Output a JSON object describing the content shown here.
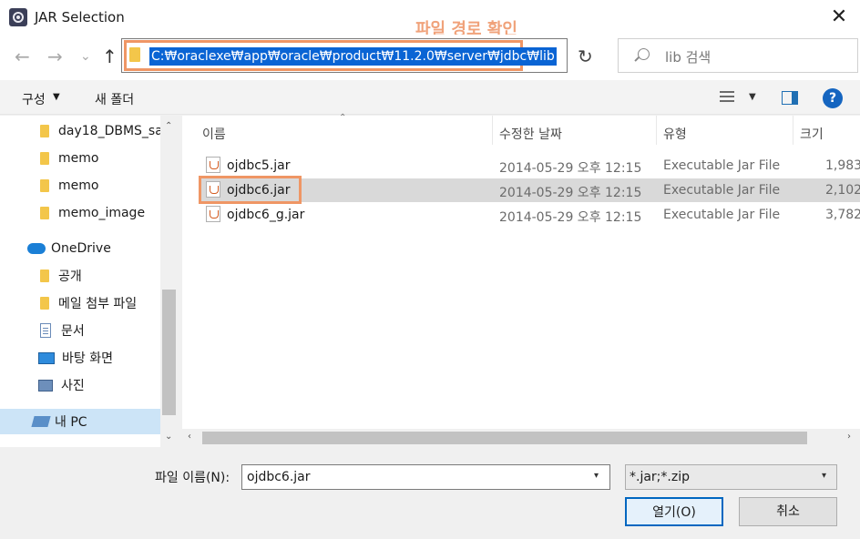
{
  "window": {
    "title": "JAR Selection",
    "close_glyph": "✕",
    "app_icon": "eclipse-icon"
  },
  "annotation": {
    "text": "파일 경로 확인",
    "color": "#ef9665"
  },
  "nav": {
    "back_glyph": "←",
    "forward_glyph": "→",
    "recent_glyph": "⌄",
    "up_glyph": "↑",
    "address": "C:₩oraclexe₩app₩oracle₩product₩11.2.0₩server₩jdbc₩lib",
    "address_chevron": "⌄",
    "refresh_glyph": "↻",
    "search_placeholder": "lib 검색"
  },
  "toolbar": {
    "organize": "구성",
    "organize_caret": "▼",
    "new_folder": "새 폴더",
    "view_caret": "▼",
    "help": "?"
  },
  "sidebar": {
    "items": [
      {
        "label": "day18_DBMS_sa",
        "icon": "folder-icon"
      },
      {
        "label": "memo",
        "icon": "folder-icon"
      },
      {
        "label": "memo",
        "icon": "folder-icon"
      },
      {
        "label": "memo_image",
        "icon": "folder-icon"
      },
      {
        "label": "OneDrive",
        "icon": "onedrive-icon"
      },
      {
        "label": "공개",
        "icon": "folder-icon"
      },
      {
        "label": "메일 첨부 파일",
        "icon": "folder-icon"
      },
      {
        "label": "문서",
        "icon": "document-icon"
      },
      {
        "label": "바탕 화면",
        "icon": "desktop-icon"
      },
      {
        "label": "사진",
        "icon": "pictures-icon"
      },
      {
        "label": "내 PC",
        "icon": "pc-icon"
      }
    ]
  },
  "columns": {
    "name": "이름",
    "modified": "수정한 날짜",
    "type": "유형",
    "size": "크기"
  },
  "files": [
    {
      "name": "ojdbc5.jar",
      "modified": "2014-05-29 오후 12:15",
      "type": "Executable Jar File",
      "size": "1,983"
    },
    {
      "name": "ojdbc6.jar",
      "modified": "2014-05-29 오후 12:15",
      "type": "Executable Jar File",
      "size": "2,102"
    },
    {
      "name": "ojdbc6_g.jar",
      "modified": "2014-05-29 오후 12:15",
      "type": "Executable Jar File",
      "size": "3,782"
    }
  ],
  "bottom": {
    "filename_label": "파일 이름(N):",
    "filename_value": "ojdbc6.jar",
    "filter_value": "*.jar;*.zip",
    "open_button": "열기(O)",
    "cancel_button": "취소"
  },
  "colors": {
    "accent": "#0067c0",
    "highlight_outline": "#ef9665",
    "selection": "#0a64d4",
    "row_selected": "#d9d9d9"
  }
}
